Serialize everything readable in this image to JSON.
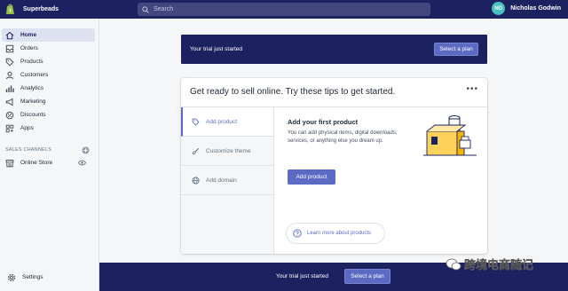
{
  "topbar": {
    "store_name": "Superbeads",
    "search_placeholder": "Search",
    "user_initials": "NG",
    "user_name": "Nicholas Godwin"
  },
  "sidebar": {
    "items": [
      {
        "label": "Home",
        "icon": "home-icon",
        "active": true
      },
      {
        "label": "Orders",
        "icon": "orders-icon"
      },
      {
        "label": "Products",
        "icon": "tag-icon"
      },
      {
        "label": "Customers",
        "icon": "customers-icon"
      },
      {
        "label": "Analytics",
        "icon": "analytics-icon"
      },
      {
        "label": "Marketing",
        "icon": "marketing-icon"
      },
      {
        "label": "Discounts",
        "icon": "discounts-icon"
      },
      {
        "label": "Apps",
        "icon": "apps-icon"
      }
    ],
    "sales_channels_title": "SALES CHANNELS",
    "channels": [
      {
        "label": "Online Store",
        "icon": "store-icon"
      }
    ],
    "settings_label": "Settings"
  },
  "trial_banner": {
    "text": "Your trial just started",
    "button": "Select a plan"
  },
  "card": {
    "title": "Get ready to sell online. Try these tips to get started.",
    "more": "•••",
    "tabs": [
      {
        "label": "Add product",
        "icon": "tag-icon",
        "active": true
      },
      {
        "label": "Customize theme",
        "icon": "brush-icon"
      },
      {
        "label": "Add domain",
        "icon": "globe-icon"
      }
    ],
    "panel": {
      "title": "Add your first product",
      "description": "You can add physical items, digital downloads, services, or anything else you dream up.",
      "button": "Add product"
    },
    "learn_more": "Learn more about products"
  },
  "bottom_banner": {
    "text": "Your trial just started",
    "button": "Select a plan"
  },
  "watermark": {
    "text": "跨境电商随记"
  },
  "colors": {
    "nav_dark": "#1c2260",
    "accent": "#5c6ac4",
    "avatar": "#47c1bf"
  }
}
